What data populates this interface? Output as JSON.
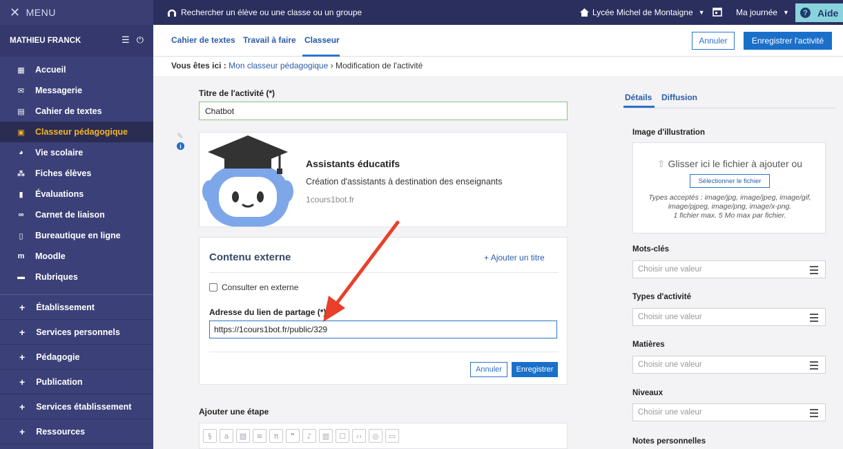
{
  "topbar": {
    "menu_label": "MENU",
    "search_text": "Rechercher un élève ou une classe ou un groupe",
    "school": "Lycée Michel de Montaigne",
    "myday": "Ma journée",
    "help": "Aide"
  },
  "sidebar": {
    "user": "MATHIEU FRANCK",
    "items": [
      {
        "label": "Accueil",
        "icon": "grid-icon"
      },
      {
        "label": "Messagerie",
        "icon": "mail-icon"
      },
      {
        "label": "Cahier de textes",
        "icon": "book-icon"
      },
      {
        "label": "Classeur pédagogique",
        "icon": "binder-icon"
      },
      {
        "label": "Vie scolaire",
        "icon": "pie-icon"
      },
      {
        "label": "Fiches élèves",
        "icon": "people-icon"
      },
      {
        "label": "Évaluations",
        "icon": "bars-icon"
      },
      {
        "label": "Carnet de liaison",
        "icon": "link-icon"
      },
      {
        "label": "Bureautique en ligne",
        "icon": "office-icon"
      },
      {
        "label": "Moodle",
        "icon": "moodle-icon"
      },
      {
        "label": "Rubriques",
        "icon": "folder-icon"
      }
    ],
    "groups": [
      "Établissement",
      "Services personnels",
      "Pédagogie",
      "Publication",
      "Services établissement",
      "Ressources"
    ]
  },
  "tabs": {
    "t1": "Cahier de textes",
    "t2": "Travail à faire",
    "t3": "Classeur",
    "cancel": "Annuler",
    "save_activity": "Enregistrer l'activité"
  },
  "breadcrumb": {
    "prefix": "Vous êtes ici :",
    "link": "Mon classeur pédagogique",
    "sep": "›",
    "current": "Modification de l'activité"
  },
  "form": {
    "title_label": "Titre de l'activité (*)",
    "title_value": "Chatbot",
    "preview": {
      "title": "Assistants éducatifs",
      "desc": "Création d'assistants à destination des enseignants",
      "url": "1cours1bot.fr"
    },
    "external": {
      "title": "Contenu externe",
      "add_title": "Ajouter un titre",
      "checkbox_label": "Consulter en externe",
      "address_label": "Adresse du lien de partage (*)",
      "address_value": "https://1cours1bot.fr/public/329",
      "cancel": "Annuler",
      "save": "Enregistrer"
    },
    "step_label": "Ajouter une étape"
  },
  "right": {
    "tab_details": "Détails",
    "tab_diffusion": "Diffusion",
    "image_label": "Image d'illustration",
    "drop_text": "Glisser ici le fichier à ajouter ou",
    "select_file": "Sélectionner le fichier",
    "types_line1": "Types acceptés : image/jpg, image/jpeg, image/gif,",
    "types_line2": "image/pjpeg, image/png, image/x-png.",
    "types_line3": "1 fichier max. 5 Mo max par fichier.",
    "keywords": "Mots-clés",
    "types": "Types d'activité",
    "subjects": "Matières",
    "levels": "Niveaux",
    "notes": "Notes personnelles",
    "placeholder": "Choisir une valeur"
  },
  "colors": {
    "topbar": "#2b2f5e",
    "sidebar": "#3c4078",
    "active_text": "#f3b229",
    "primary": "#1a70c9",
    "arrow": "#e8402a"
  }
}
